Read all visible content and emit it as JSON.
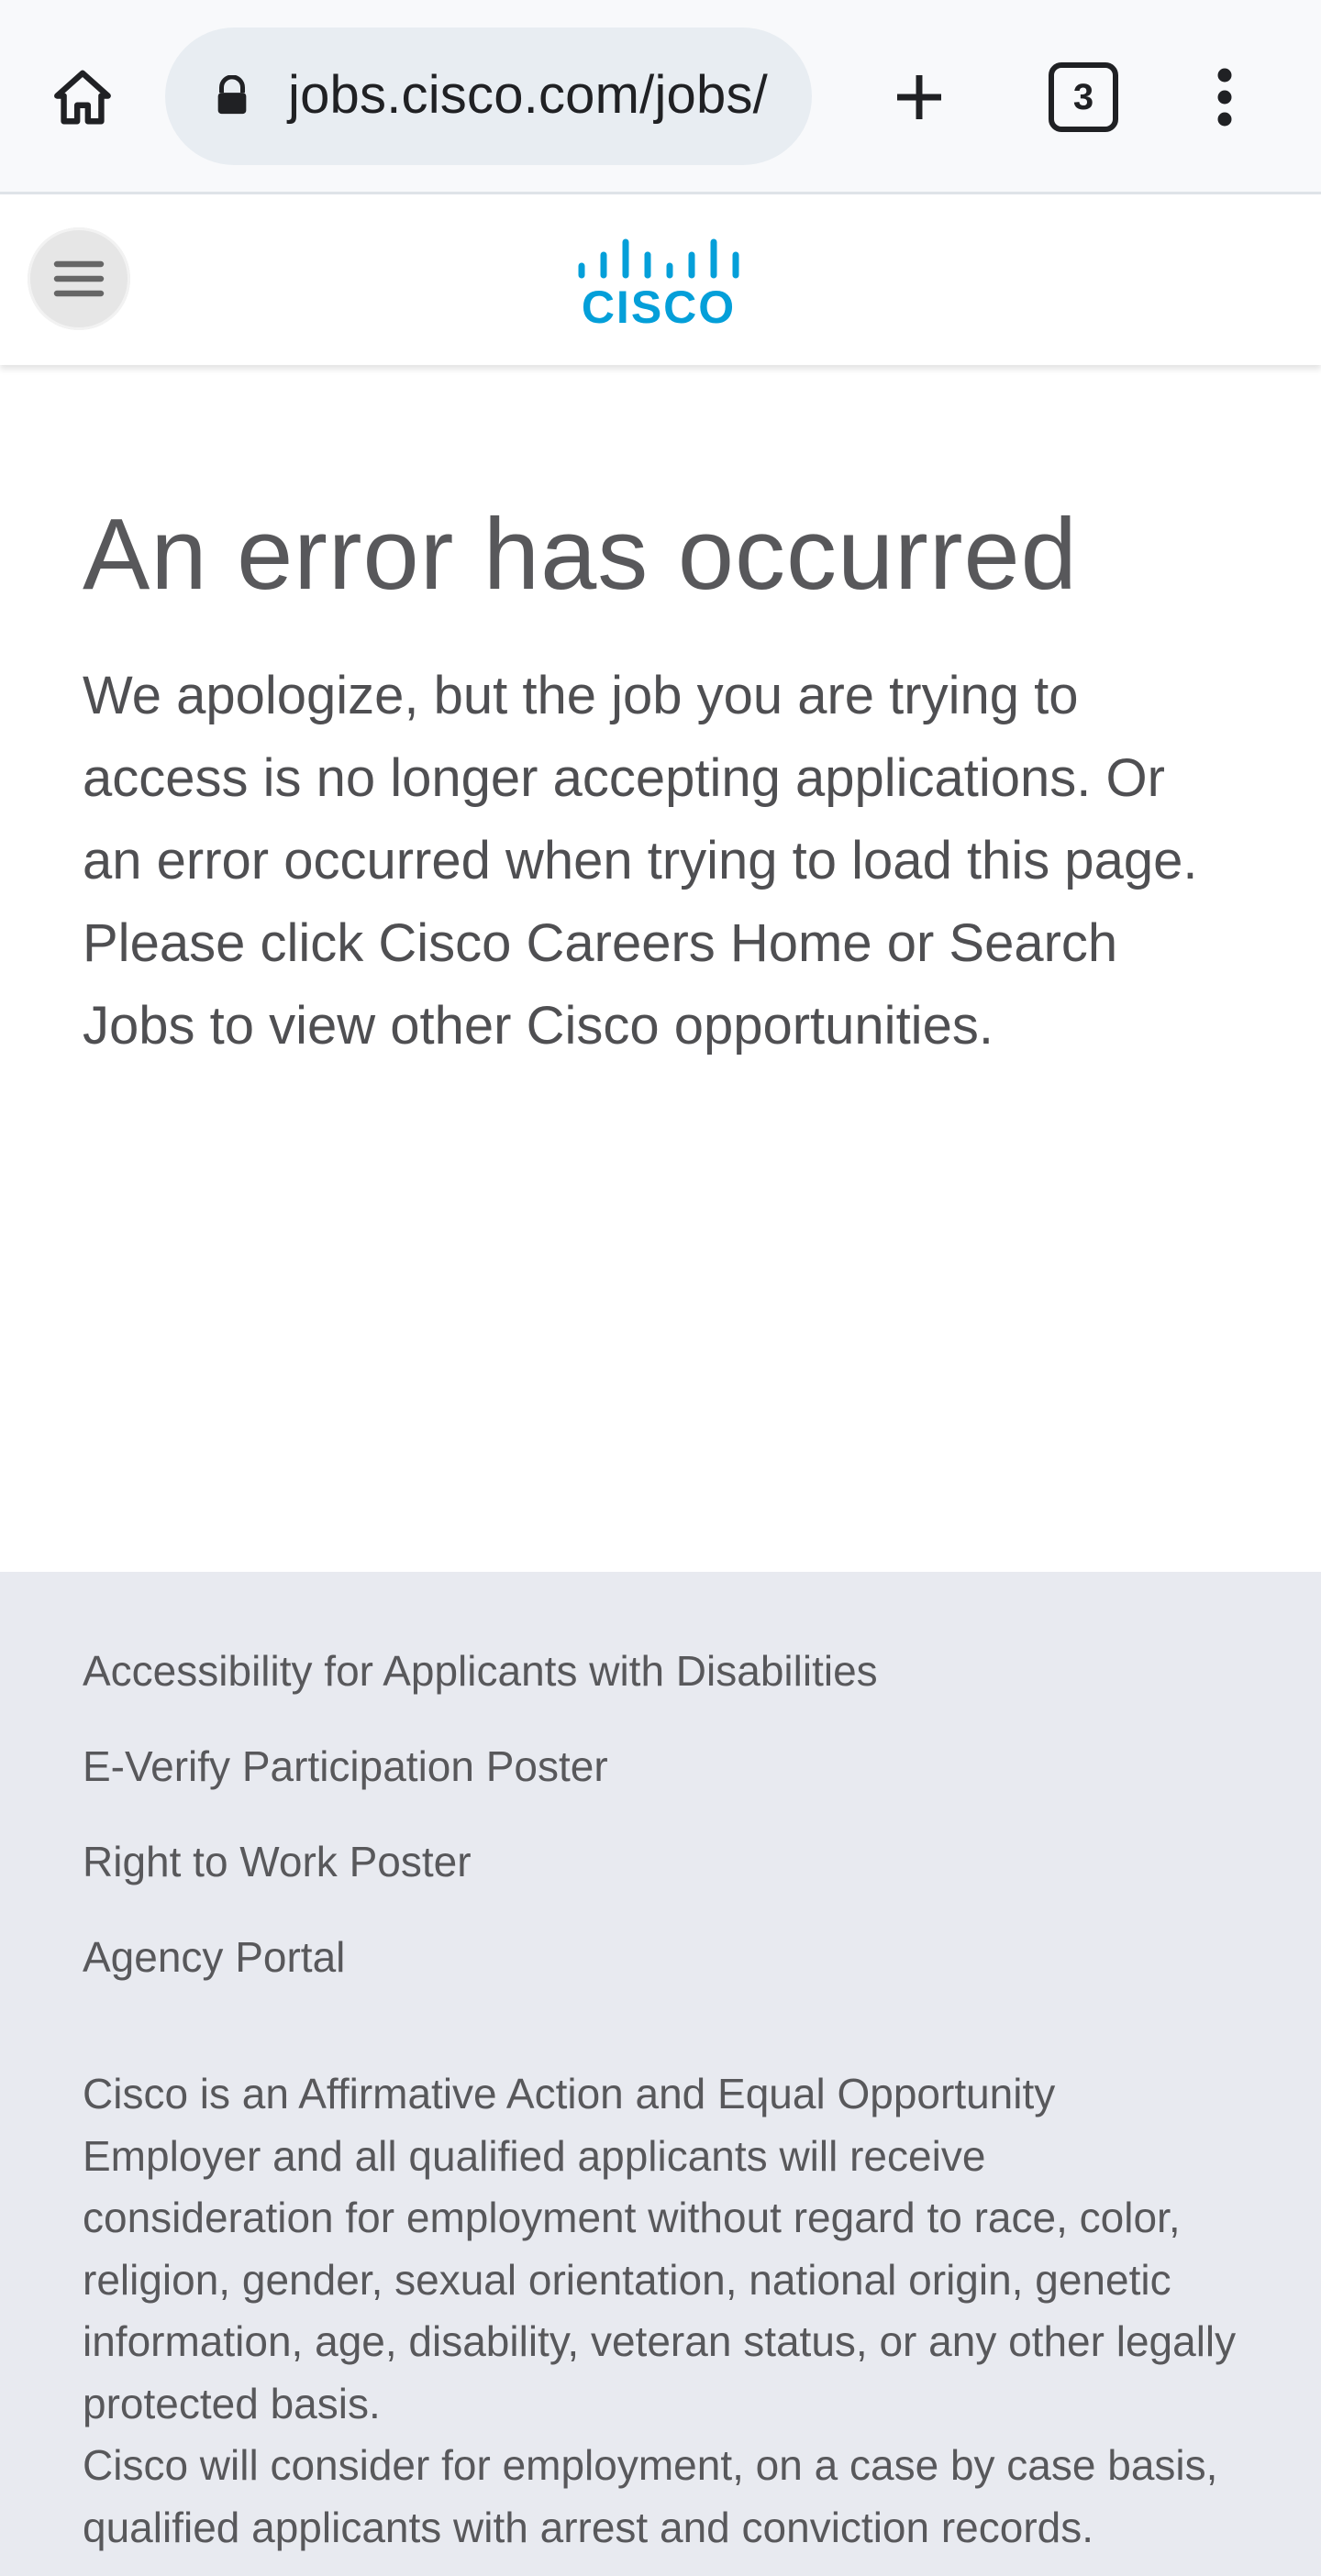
{
  "browser": {
    "url": "jobs.cisco.com/jobs/",
    "tab_count": "3"
  },
  "header": {
    "logo_text": "CISCO"
  },
  "main": {
    "title": "An error has occurred",
    "body": "We apologize, but the job you are trying to access is no longer accepting applications. Or an error occurred when trying to load this page. Please click Cisco Careers Home or Search Jobs to view other Cisco opportunities."
  },
  "footer": {
    "links": [
      "Accessibility for Applicants with Disabilities",
      "E-Verify Participation Poster",
      "Right to Work Poster",
      "Agency Portal"
    ],
    "eeo_paragraph_1": "Cisco is an Affirmative Action and Equal Opportunity Employer and all qualified applicants will receive consideration for employment without regard to race, color, religion, gender, sexual orientation, national origin, genetic information, age, disability, veteran status, or any other legally protected basis.",
    "eeo_paragraph_2": "Cisco will consider for employment, on a case by case basis, qualified applicants with arrest and conviction records."
  },
  "colors": {
    "cisco_blue": "#049fd9",
    "text_gray": "#58585b",
    "footer_bg": "#e8eaf0",
    "chrome_bg": "#f8f9fb"
  }
}
